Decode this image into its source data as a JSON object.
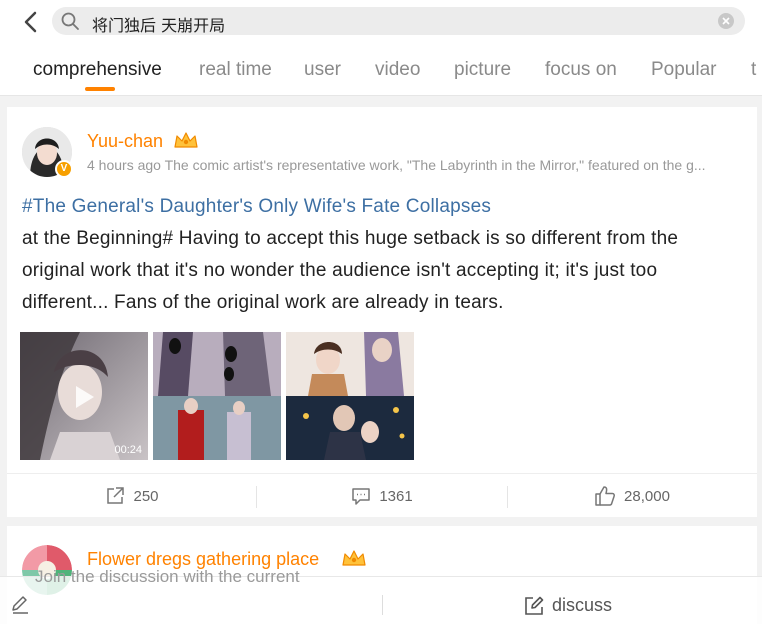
{
  "search": {
    "query": "将门独后 天崩开局"
  },
  "tabs": [
    "comprehensive",
    "real time",
    "user",
    "video",
    "picture",
    "focus on",
    "Popular",
    "t"
  ],
  "colors": {
    "accent": "#ff8200",
    "topic": "#3d6fa3"
  },
  "post": {
    "username": "Yuu-chan",
    "meta": "4 hours ago The comic artist's representative work, \"The Labyrinth in the Mirror,\" featured on the g...",
    "topic": "#The General's Daughter's Only Wife's Fate Collapses",
    "text": "at the Beginning# Having to accept this huge setback is so different from the original work that it's no wonder the audience isn't accepting it; it's just too different... Fans of the original work are already in tears.",
    "video_duration": "00:24",
    "reposts": "250",
    "comments": "1361",
    "likes": "28,000"
  },
  "post2": {
    "username": "Flower dregs gathering place"
  },
  "bottom": {
    "placeholder": "Join the discussion with the current",
    "discuss_label": "discuss"
  }
}
